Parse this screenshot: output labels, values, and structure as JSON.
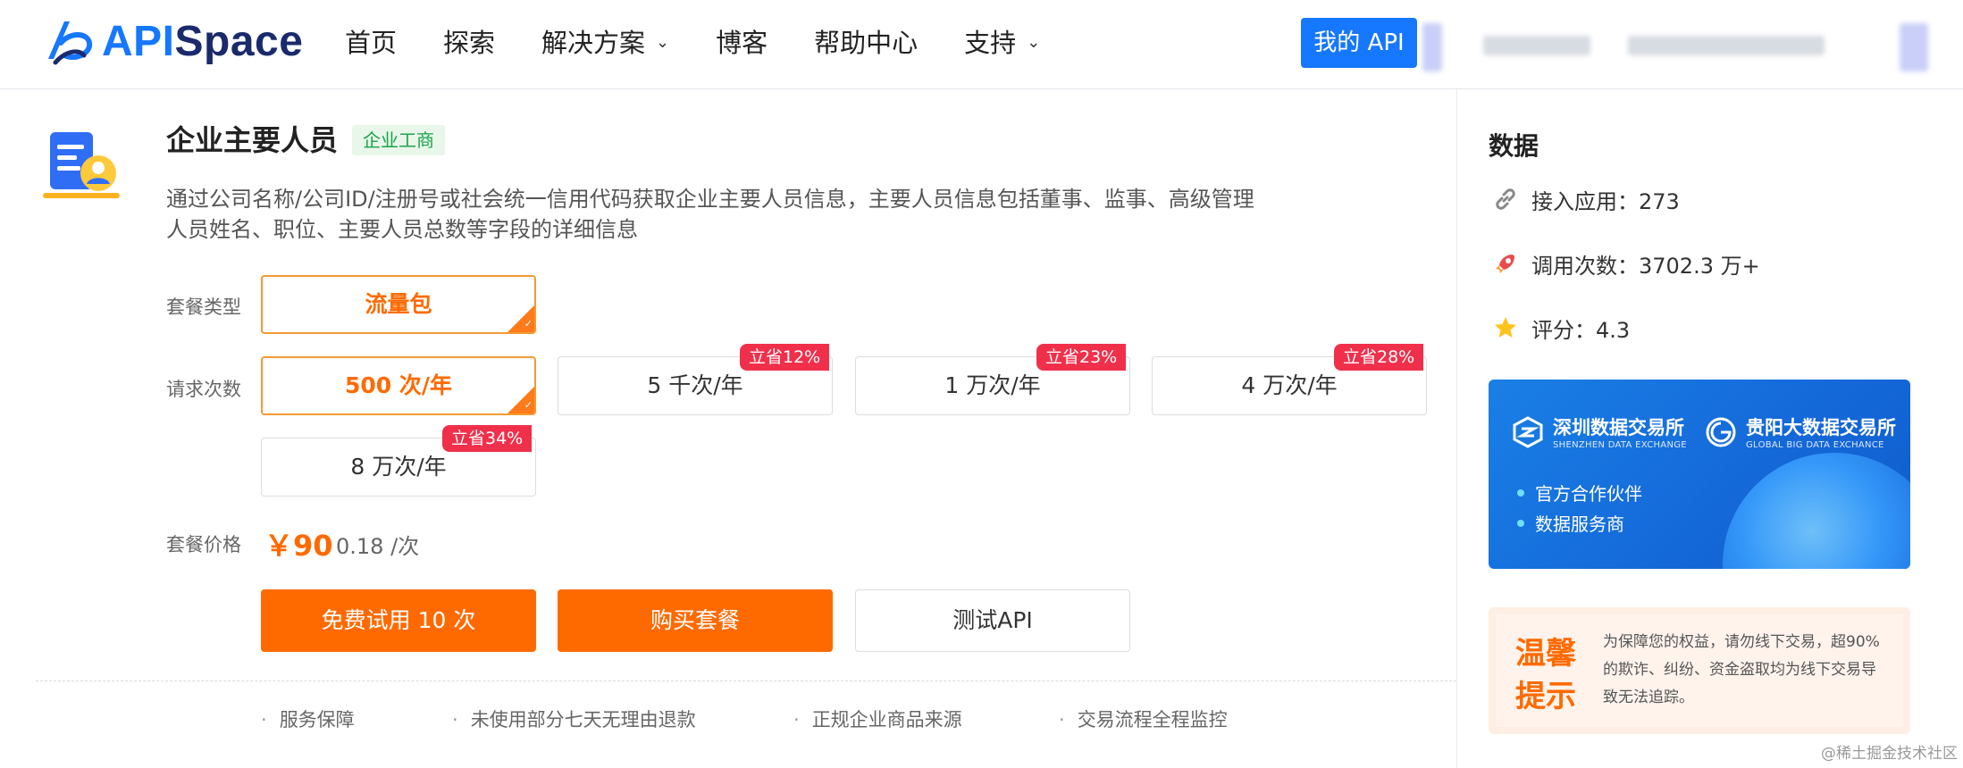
{
  "header": {
    "logo_api": "API",
    "logo_space": "Space",
    "nav": [
      {
        "label": "首页",
        "has_dropdown": false
      },
      {
        "label": "探索",
        "has_dropdown": false
      },
      {
        "label": "解决方案",
        "has_dropdown": true
      },
      {
        "label": "博客",
        "has_dropdown": false
      },
      {
        "label": "帮助中心",
        "has_dropdown": false
      },
      {
        "label": "支持",
        "has_dropdown": true
      }
    ],
    "my_api": "我的 API"
  },
  "product": {
    "title": "企业主要人员",
    "tag": "企业工商",
    "description": "通过公司名称/公司ID/注册号或社会统一信用代码获取企业主要人员信息，主要人员信息包括董事、监事、高级管理人员姓名、职位、主要人员总数等字段的详细信息"
  },
  "plan": {
    "type_label": "套餐类型",
    "type_options": [
      {
        "label": "流量包",
        "selected": true
      }
    ],
    "count_label": "请求次数",
    "count_options": [
      {
        "label": "500 次/年",
        "selected": true,
        "badge": ""
      },
      {
        "label": "5 千次/年",
        "selected": false,
        "badge": "立省12%"
      },
      {
        "label": "1 万次/年",
        "selected": false,
        "badge": "立省23%"
      },
      {
        "label": "4 万次/年",
        "selected": false,
        "badge": "立省28%"
      },
      {
        "label": "8 万次/年",
        "selected": false,
        "badge": "立省34%"
      }
    ],
    "price_label": "套餐价格",
    "price": "￥90",
    "unit_price": "0.18 /次"
  },
  "actions": {
    "trial": "免费试用 10 次",
    "buy": "购买套餐",
    "test": "测试API"
  },
  "guarantees": [
    "服务保障",
    "未使用部分七天无理由退款",
    "正规企业商品来源",
    "交易流程全程监控"
  ],
  "stats": {
    "title": "数据",
    "apps": "接入应用：273",
    "calls": "调用次数：3702.3 万+",
    "rating": "评分：4.3"
  },
  "partners": {
    "shenzhen_name": "深圳数据交易所",
    "shenzhen_en": "SHENZHEN DATA EXCHANGE",
    "guiyang_name": "贵阳大数据交易所",
    "guiyang_en": "GLOBAL BIG DATA EXCHANCE",
    "bullets": [
      "官方合作伙伴",
      "数据服务商"
    ]
  },
  "notice": {
    "title": "温馨提示",
    "text": "为保障您的权益，请勿线下交易，超90%的欺诈、纠纷、资金盗取均为线下交易导致无法追踪。"
  },
  "watermark": "@稀土掘金技术社区",
  "colors": {
    "brand": "#1677ff",
    "accent": "#ff6a00",
    "badge": "#f0304b",
    "tag_green": "#1aa34a"
  }
}
